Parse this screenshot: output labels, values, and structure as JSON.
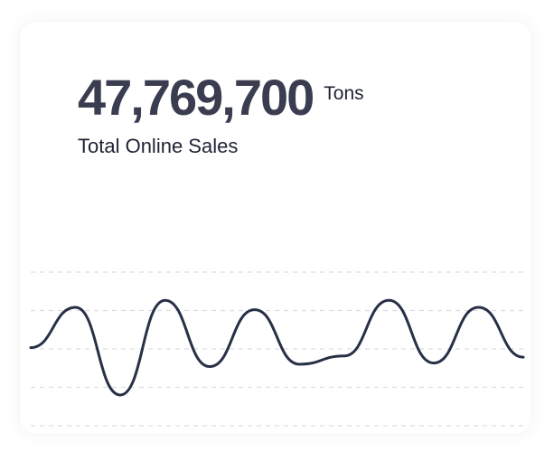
{
  "metric": {
    "value": "47,769,700",
    "unit": "Tons",
    "label": "Total Online Sales"
  },
  "colors": {
    "line": "#283046",
    "grid": "#dcdde3",
    "value_text": "#3a3c50",
    "label_text": "#1f2233"
  },
  "chart_data": {
    "type": "line",
    "title": "",
    "xlabel": "",
    "ylabel": "",
    "grid": "horizontal-dashed",
    "legend": "none",
    "ylim": [
      0,
      100
    ],
    "x": [
      0,
      1,
      2,
      3,
      4,
      5,
      6,
      7,
      8,
      9,
      10,
      11
    ],
    "series": [
      {
        "values": [
          40,
          74,
          0,
          80,
          24,
          72,
          26,
          33,
          80,
          27,
          74,
          32
        ]
      }
    ]
  }
}
